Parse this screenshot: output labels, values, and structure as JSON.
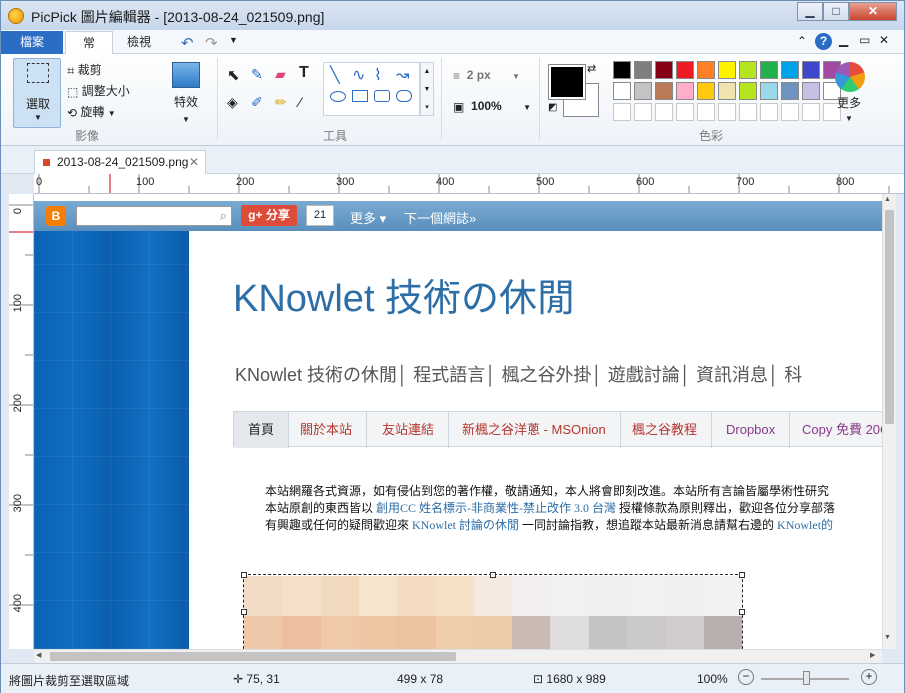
{
  "window": {
    "title": "PicPick 圖片編輯器 - [2013-08-24_021509.png]",
    "controls": {
      "minimize": "▁",
      "maximize": "□",
      "close": "✕"
    }
  },
  "ribbon_tabs": [
    "檔案",
    "常用",
    "檢視"
  ],
  "ribbon_right": {
    "collapse": "⌃",
    "help": "?",
    "restore": "▭",
    "close": "✕"
  },
  "image_group": {
    "select_label": "選取",
    "crop": "裁剪",
    "resize": "調整大小",
    "rotate": "旋轉",
    "effects": "特效",
    "group_label": "影像"
  },
  "tools_group": {
    "label": "工具"
  },
  "line_settings": {
    "width": "2 px",
    "opacity": "100%"
  },
  "colors_group": {
    "label": "色彩",
    "more": "更多",
    "primary": "#000000",
    "secondary": "#ffffff",
    "palette_row1": [
      "#000000",
      "#7f7f7f",
      "#880015",
      "#ed1c24",
      "#ff7f27",
      "#fff200",
      "#b5e61d",
      "#22b14c",
      "#00a2e8",
      "#3f48cc",
      "#a349a4"
    ],
    "palette_row2": [
      "#ffffff",
      "#c3c3c3",
      "#b97a57",
      "#ffaec9",
      "#ffc90e",
      "#efe4b0",
      "#b5e61d",
      "#99d9ea",
      "#7092be",
      "#c8bfe7",
      "#ffffff"
    ]
  },
  "document_tab": {
    "name": "2013-08-24_021509.png",
    "close": "✕"
  },
  "ruler": {
    "h_ticks": [
      "0",
      "100",
      "200",
      "300",
      "400",
      "500",
      "600",
      "700",
      "800"
    ],
    "v_ticks": [
      "0",
      "100",
      "200",
      "300",
      "400"
    ]
  },
  "blog": {
    "search_placeholder": "",
    "share_label": "g+ 分享",
    "share_count": "21",
    "more": "更多 ▾",
    "next_blog": "下一個網誌»",
    "site_title": "KNowlet 技術の休閒",
    "site_links": "KNowlet 技術の休閒│ 程式語言│ 楓之谷外掛│ 遊戲討論│ 資訊消息│ 科",
    "nav": [
      "首頁",
      "關於本站",
      "友站連結",
      "新楓之谷洋蔥 - MSOnion",
      "楓之谷教程",
      "Dropbox",
      "Copy 免費 20G"
    ],
    "para_line1": "本站網羅各式資源，如有侵佔到您的著作權，敬請通知，本人將會即刻改進。本站所有言論皆屬學術性研究",
    "para_line2a": "本站原創的東西皆以",
    "para_line2_link": "創用CC 姓名標示-非商業性-禁止改作 3.0 台灣",
    "para_line2b": "授權條款為原則釋出，歡迎各位分享部落",
    "para_line3a": "有興趣或任何的疑問歡迎來",
    "para_line3_link": "KNowlet 討論の休閒",
    "para_line3b": "一同討論指教，想追蹤本站最新消息請幫右邊的",
    "para_line3_link2": "KNowlet的"
  },
  "status": {
    "hint": "將圖片裁剪至選取區域",
    "cursor": "75, 31",
    "selection": "499 x 78",
    "image_size": "1680 x 989",
    "zoom": "100%"
  }
}
